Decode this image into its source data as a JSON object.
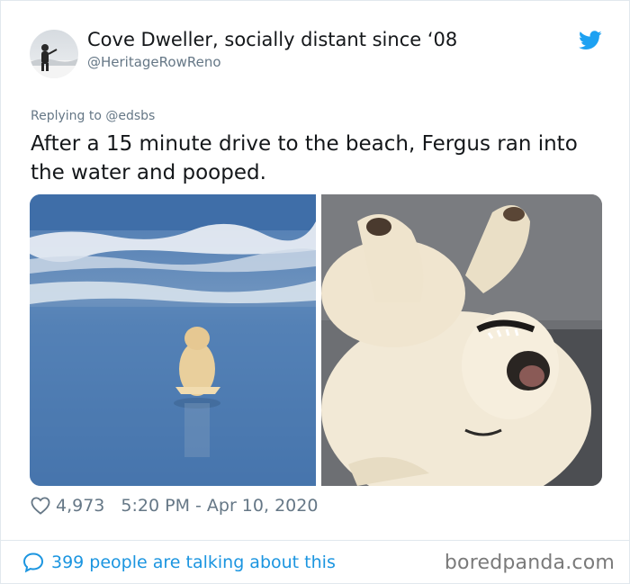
{
  "tweet": {
    "author": {
      "display_name": "Cove Dweller, socially distant since ‘08",
      "handle": "@HeritageRowReno",
      "avatar": "avatar"
    },
    "platform_icon": "twitter-bird-icon",
    "brand_color": "#1da1f2",
    "replying_to": "Replying to @edsbs",
    "text": "After a 15 minute drive to the beach, Fergus ran into the water and pooped.",
    "media": [
      {
        "name": "photo-dog-in-ocean"
      },
      {
        "name": "photo-dog-on-back-on-couch"
      }
    ],
    "likes": "4,973",
    "timestamp": "5:20 PM - Apr 10, 2020",
    "conversation": "399 people are talking about this",
    "link_color": "#1b95e0",
    "muted_color": "#657786"
  },
  "watermark": "boredpanda.com"
}
